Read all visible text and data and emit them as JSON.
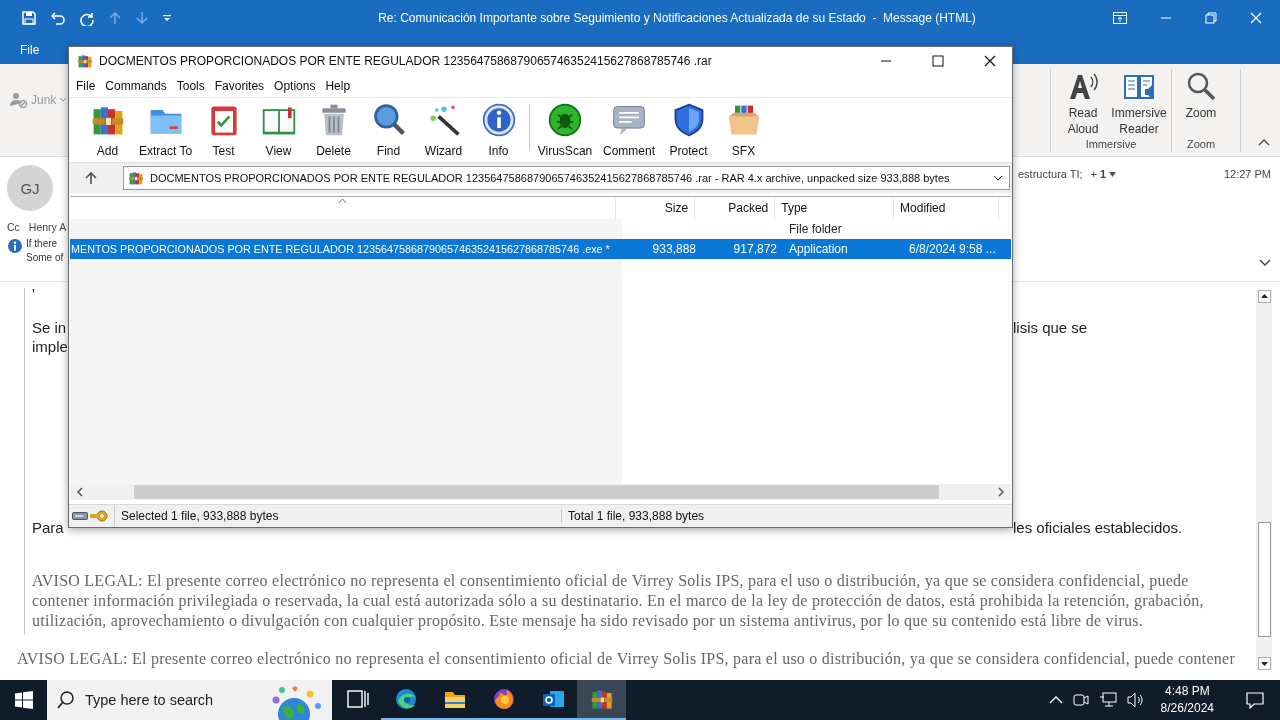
{
  "outlook": {
    "title": "Re: Comunicación Importante sobre Seguimiento y Notificaciones Actualizada de su Estado  -  Message (HTML)",
    "tabs": [
      {
        "label": "File",
        "selected": false
      }
    ],
    "ribbon": {
      "junk": "Junk",
      "groups": [
        {
          "name": "Immersive",
          "buttons": [
            {
              "label": "Read Aloud",
              "kind": "read"
            },
            {
              "label": "Immersive Reader",
              "kind": "reader"
            }
          ]
        },
        {
          "name": "Zoom",
          "buttons": [
            {
              "label": "Zoom",
              "kind": "zoom"
            }
          ]
        }
      ]
    },
    "header": {
      "avatar": "GJ",
      "cc_label": "Cc",
      "cc": "Henry A",
      "info_lines": [
        "If there",
        "Some of"
      ],
      "to_fragment": "estructura TI;",
      "more": "+ **1**",
      "time": "12:27 PM"
    },
    "body": {
      "mark": "'",
      "paragraphs": [
        {
          "left": [
            "Se in",
            "imple"
          ],
          "right": [
            "lisis que se"
          ]
        },
        {
          "left": [
            "Para"
          ],
          "right": [
            "les oficiales establecidos."
          ]
        }
      ],
      "legal": "AVISO LEGAL: El presente correo electrónico no representa el consentimiento oficial de Virrey Solis IPS, para el uso o distribución, ya que se considera confidencial, puede contener información privilegiada o reservada, la cual está autorizada sólo a su destinatario. En el marco de la ley de protección de datos, está prohibida la retención, grabación, utilización, aprovechamiento o divulgación con cualquier propósito. Este mensaje ha sido revisado por un sistema antivirus, por lo que su contenido está libre de virus.",
      "legal_repeat": "AVISO LEGAL: El presente correo electrónico no representa el consentimiento oficial de Virrey Solis IPS, para el uso o distribución, ya que se considera confidencial, puede contener"
    }
  },
  "archive_window": {
    "title": "DOCMENTOS PROPORCIONADOS POR ENTE REGULADOR 1235647586879065746352415627868785746 .rar",
    "menu": [
      "File",
      "Commands",
      "Tools",
      "Favorites",
      "Options",
      "Help"
    ],
    "toolbar_groups": [
      [
        {
          "label": "Add",
          "kind": "add"
        },
        {
          "label": "Extract To",
          "kind": "extract"
        },
        {
          "label": "Test",
          "kind": "test"
        },
        {
          "label": "View",
          "kind": "view"
        },
        {
          "label": "Delete",
          "kind": "delete"
        },
        {
          "label": "Find",
          "kind": "find"
        },
        {
          "label": "Wizard",
          "kind": "wizard"
        },
        {
          "label": "Info",
          "kind": "info"
        }
      ],
      [
        {
          "label": "VirusScan",
          "kind": "virusscan"
        },
        {
          "label": "Comment",
          "kind": "comment"
        },
        {
          "label": "Protect",
          "kind": "protect"
        },
        {
          "label": "SFX",
          "kind": "sfx"
        }
      ]
    ],
    "path": "DOCMENTOS PROPORCIONADOS POR ENTE REGULADOR 1235647586879065746352415627868785746 .rar - RAR 4.x archive, unpacked size 933,888 bytes",
    "columns": [
      {
        "sorted": true
      },
      {
        "label": "Size",
        "sorted": false
      },
      {
        "label": "Packed",
        "sorted": false
      },
      {
        "label": "Type",
        "sorted": false
      },
      {
        "label": "Modified",
        "sorted": false
      }
    ],
    "rows": [
      {
        "cells": [
          null,
          null,
          null,
          "File folder",
          null
        ],
        "selected": false
      },
      {
        "cells": [
          "MENTOS PROPORCIONADOS POR ENTE REGULADOR 1235647586879065746352415627868785746 .exe *",
          "933,888",
          "917,872",
          "Application",
          "6/8/2024 9:58 ..."
        ],
        "selected": true
      }
    ],
    "status": [
      "Selected 1 file, 933,888 bytes",
      "Total 1 file, 933,888 bytes"
    ]
  },
  "taskbar": {
    "search_placeholder": "Type here to search",
    "apps": [
      {
        "kind": "taskview",
        "running": false,
        "selected": false
      },
      {
        "kind": "edge",
        "running": true,
        "selected": false
      },
      {
        "kind": "explorer",
        "running": true,
        "selected": false
      },
      {
        "kind": "firefox",
        "running": true,
        "selected": false
      },
      {
        "kind": "outlook",
        "running": true,
        "selected": false
      },
      {
        "kind": "winrar",
        "running": true,
        "selected": true
      }
    ],
    "time": "4:48 PM",
    "date": "8/26/2024"
  }
}
